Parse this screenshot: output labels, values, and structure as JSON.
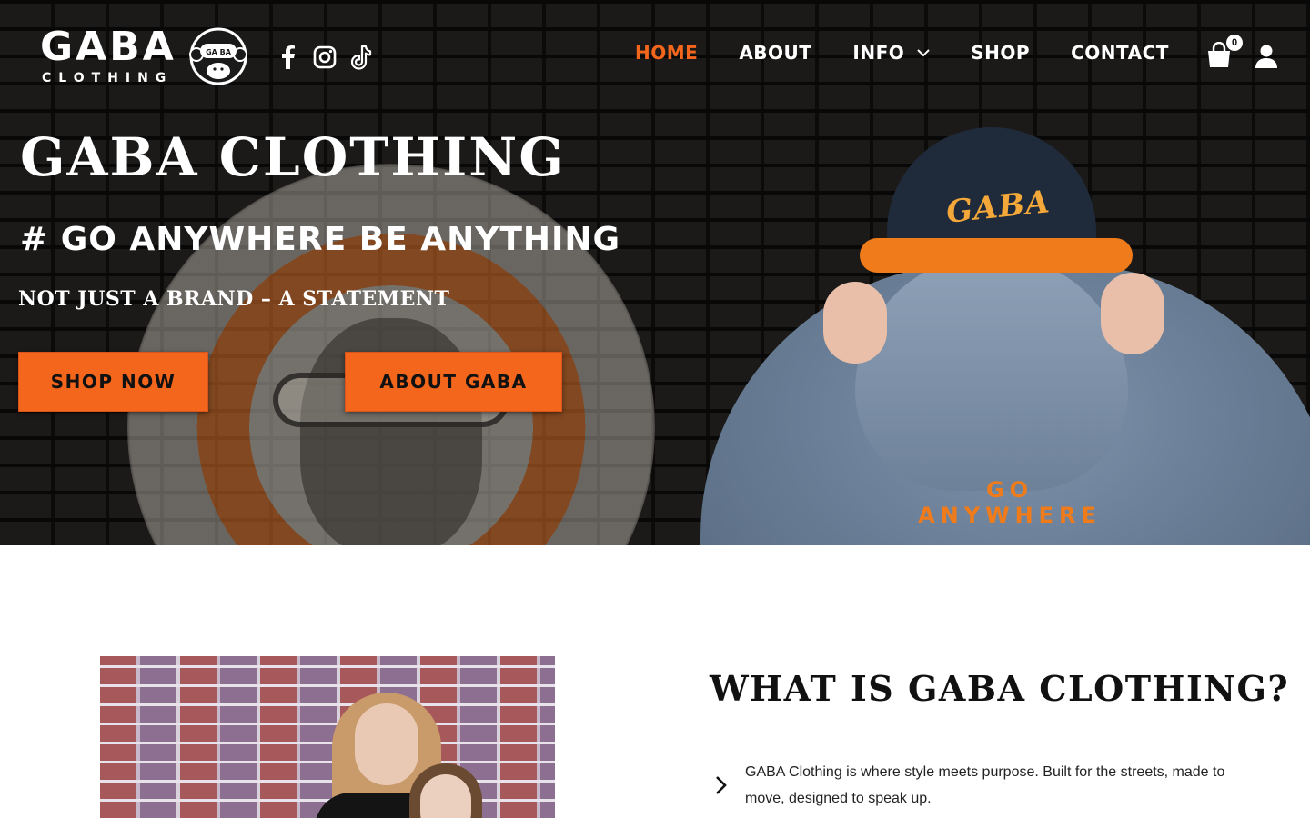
{
  "brand": {
    "logo_word": "GABA",
    "logo_sub": "CLOTHING",
    "logo_badge": "GA BA"
  },
  "socials": [
    {
      "icon": "facebook-icon"
    },
    {
      "icon": "instagram-icon"
    },
    {
      "icon": "tiktok-icon"
    }
  ],
  "nav": {
    "items": [
      {
        "label": "HOME",
        "active": true
      },
      {
        "label": "ABOUT"
      },
      {
        "label": "INFO",
        "has_dropdown": true
      },
      {
        "label": "SHOP"
      },
      {
        "label": "CONTACT"
      }
    ],
    "cart_count": "0"
  },
  "hero": {
    "title": "GABA CLOTHING",
    "subtitle": "# GO ANYWHERE BE ANYTHING",
    "tagline": "NOT JUST A BRAND – A STATEMENT",
    "cap_logo": "GABA",
    "back_print": "GO ANYWHERE",
    "buttons": {
      "shop": "SHOP NOW",
      "about": "ABOUT GABA"
    }
  },
  "what": {
    "title": "WHAT IS GABA CLOTHING?",
    "text": "GABA Clothing is where style meets purpose. Built for the streets, made to move, designed to speak up."
  },
  "colors": {
    "accent": "#f4661b",
    "hero_text": "#ffffff",
    "body_text": "#222222"
  }
}
